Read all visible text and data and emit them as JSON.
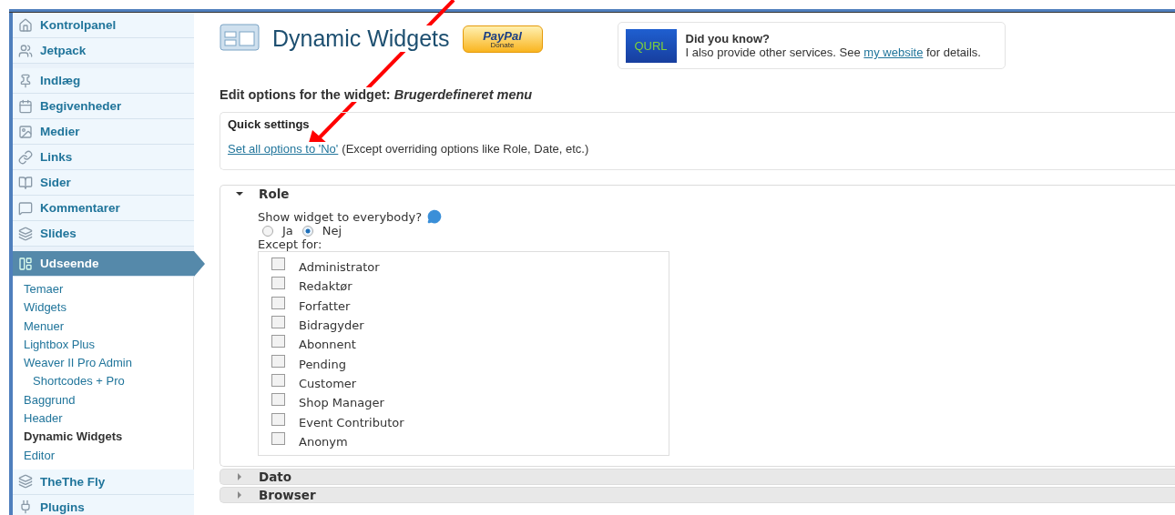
{
  "sidebar": {
    "groups": [
      {
        "items": [
          {
            "label": "Kontrolpanel",
            "selected": false
          },
          {
            "label": "Jetpack",
            "selected": false
          }
        ]
      },
      {
        "items": [
          {
            "label": "Indlæg",
            "selected": false
          },
          {
            "label": "Begivenheder",
            "selected": false
          },
          {
            "label": "Medier",
            "selected": false
          },
          {
            "label": "Links",
            "selected": false
          },
          {
            "label": "Sider",
            "selected": false
          },
          {
            "label": "Kommentarer",
            "selected": false
          },
          {
            "label": "Slides",
            "selected": false
          }
        ]
      },
      {
        "items": [
          {
            "label": "Udseende",
            "selected": true,
            "children": [
              {
                "label": "Temaer",
                "selected": false
              },
              {
                "label": "Widgets",
                "selected": false
              },
              {
                "label": "Menuer",
                "selected": false
              },
              {
                "label": "Lightbox Plus",
                "selected": false
              },
              {
                "label": "Weaver II Pro Admin",
                "selected": false,
                "children": [
                  {
                    "label": "Shortcodes + Pro",
                    "selected": false
                  }
                ]
              },
              {
                "label": "Baggrund",
                "selected": false
              },
              {
                "label": "Header",
                "selected": false
              },
              {
                "label": "Dynamic Widgets",
                "selected": true
              },
              {
                "label": "Editor",
                "selected": false
              }
            ]
          },
          {
            "label": "TheThe Fly",
            "selected": false
          },
          {
            "label": "Plugins",
            "selected": false
          }
        ]
      }
    ]
  },
  "header": {
    "title": "Dynamic Widgets",
    "donate": {
      "brand": "PayPal",
      "label": "Donate"
    }
  },
  "notice": {
    "logo": "QURL",
    "title": "Did you know?",
    "text_before": "I also provide other services. See",
    "link": "my website",
    "text_after": "for details."
  },
  "heading": {
    "label": "Edit options for the widget:",
    "widget": "Brugerdefineret menu"
  },
  "quick_settings": {
    "title": "Quick settings",
    "link": "Set all options to 'No'",
    "note": "(Except overriding options like Role, Date, etc.)"
  },
  "sections": [
    {
      "title": "Role",
      "expanded": true,
      "question": "Show widget to everybody?",
      "options": [
        {
          "label": "Ja",
          "selected": false
        },
        {
          "label": "Nej",
          "selected": true
        }
      ],
      "except_label": "Except for:",
      "roles": [
        {
          "label": "Administrator",
          "checked": false
        },
        {
          "label": "Redaktør",
          "checked": false
        },
        {
          "label": "Forfatter",
          "checked": false
        },
        {
          "label": "Bidragyder",
          "checked": false
        },
        {
          "label": "Abonnent",
          "checked": false
        },
        {
          "label": "Pending",
          "checked": false
        },
        {
          "label": "Customer",
          "checked": false
        },
        {
          "label": "Shop Manager",
          "checked": false
        },
        {
          "label": "Event Contributor",
          "checked": false
        },
        {
          "label": "Anonym",
          "checked": false
        }
      ]
    },
    {
      "title": "Dato",
      "expanded": false
    },
    {
      "title": "Browser",
      "expanded": false
    }
  ]
}
